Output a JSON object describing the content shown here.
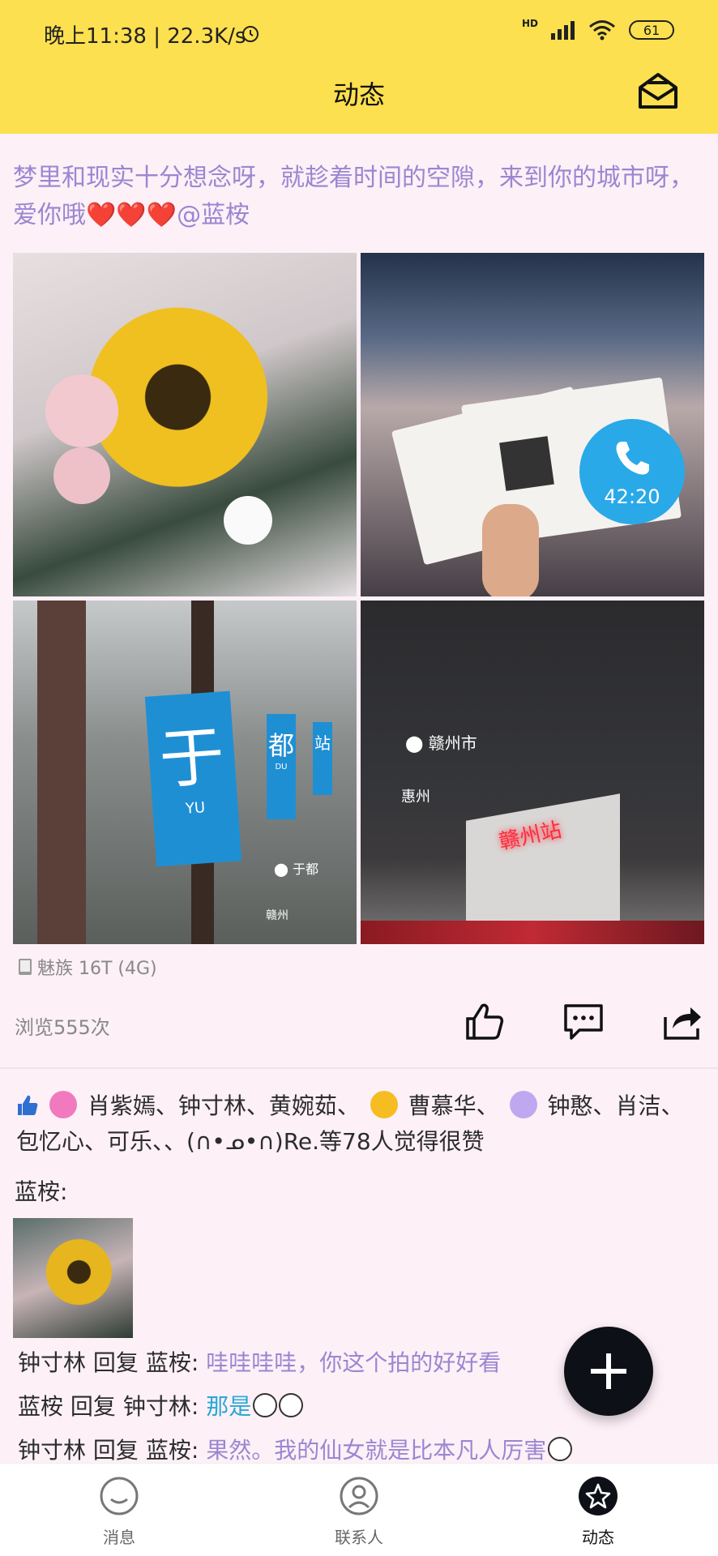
{
  "status_bar": {
    "time": "晚上11:38 | 22.3K/s",
    "battery": "61",
    "signal": "HD"
  },
  "header": {
    "title": "动态"
  },
  "post": {
    "text": "梦里和现实十分想念呀，就趁着时间的空隙，来到你的城市呀，爱你哦",
    "hearts": "❤️❤️❤️",
    "mention": "@蓝桉",
    "photos": {
      "call_time": "42:20",
      "p3_sign_main": "于",
      "p3_sign_main_sub": "YU",
      "p3_sign_2": "都",
      "p3_sign_2_sub": "DU",
      "p3_sign_3": "站",
      "p3_loc": "于都",
      "p3_loc2": "赣州",
      "p4_loc": "赣州市",
      "p4_loc2": "惠州",
      "p4_building": "赣州站"
    },
    "device": "魅族 16T (4G)",
    "views": "浏览555次"
  },
  "likes": {
    "name_1": "肖紫嫣、钟寸林、黄婉茹、",
    "name_2": "曹慕华、",
    "name_3": "钟憨、肖洁、",
    "line_2": "包忆心、可乐、、(∩•ᓄ•∩)Re.等78人觉得很赞"
  },
  "comments": {
    "author": "蓝桉:",
    "replies": [
      {
        "user": "钟寸林",
        "verb": " 回复 ",
        "target": "蓝桉",
        "msg": "哇哇哇哇，你这个拍的好好看"
      },
      {
        "user": "蓝桉",
        "verb": " 回复 ",
        "target": "钟寸林",
        "msg": "那是"
      },
      {
        "user": "钟寸林",
        "verb": " 回复 ",
        "target": "蓝桉",
        "msg": "果然。我的仙女就是比本凡人厉害"
      }
    ]
  },
  "bottom_nav": {
    "items": [
      {
        "label": "消息",
        "icon": "message-icon"
      },
      {
        "label": "联系人",
        "icon": "contacts-icon"
      },
      {
        "label": "动态",
        "icon": "star-icon"
      }
    ],
    "active": "动态"
  },
  "colors": {
    "topbar": "#fde04f",
    "accent_text": "#9b86d1",
    "background": "#fdf0f7"
  }
}
